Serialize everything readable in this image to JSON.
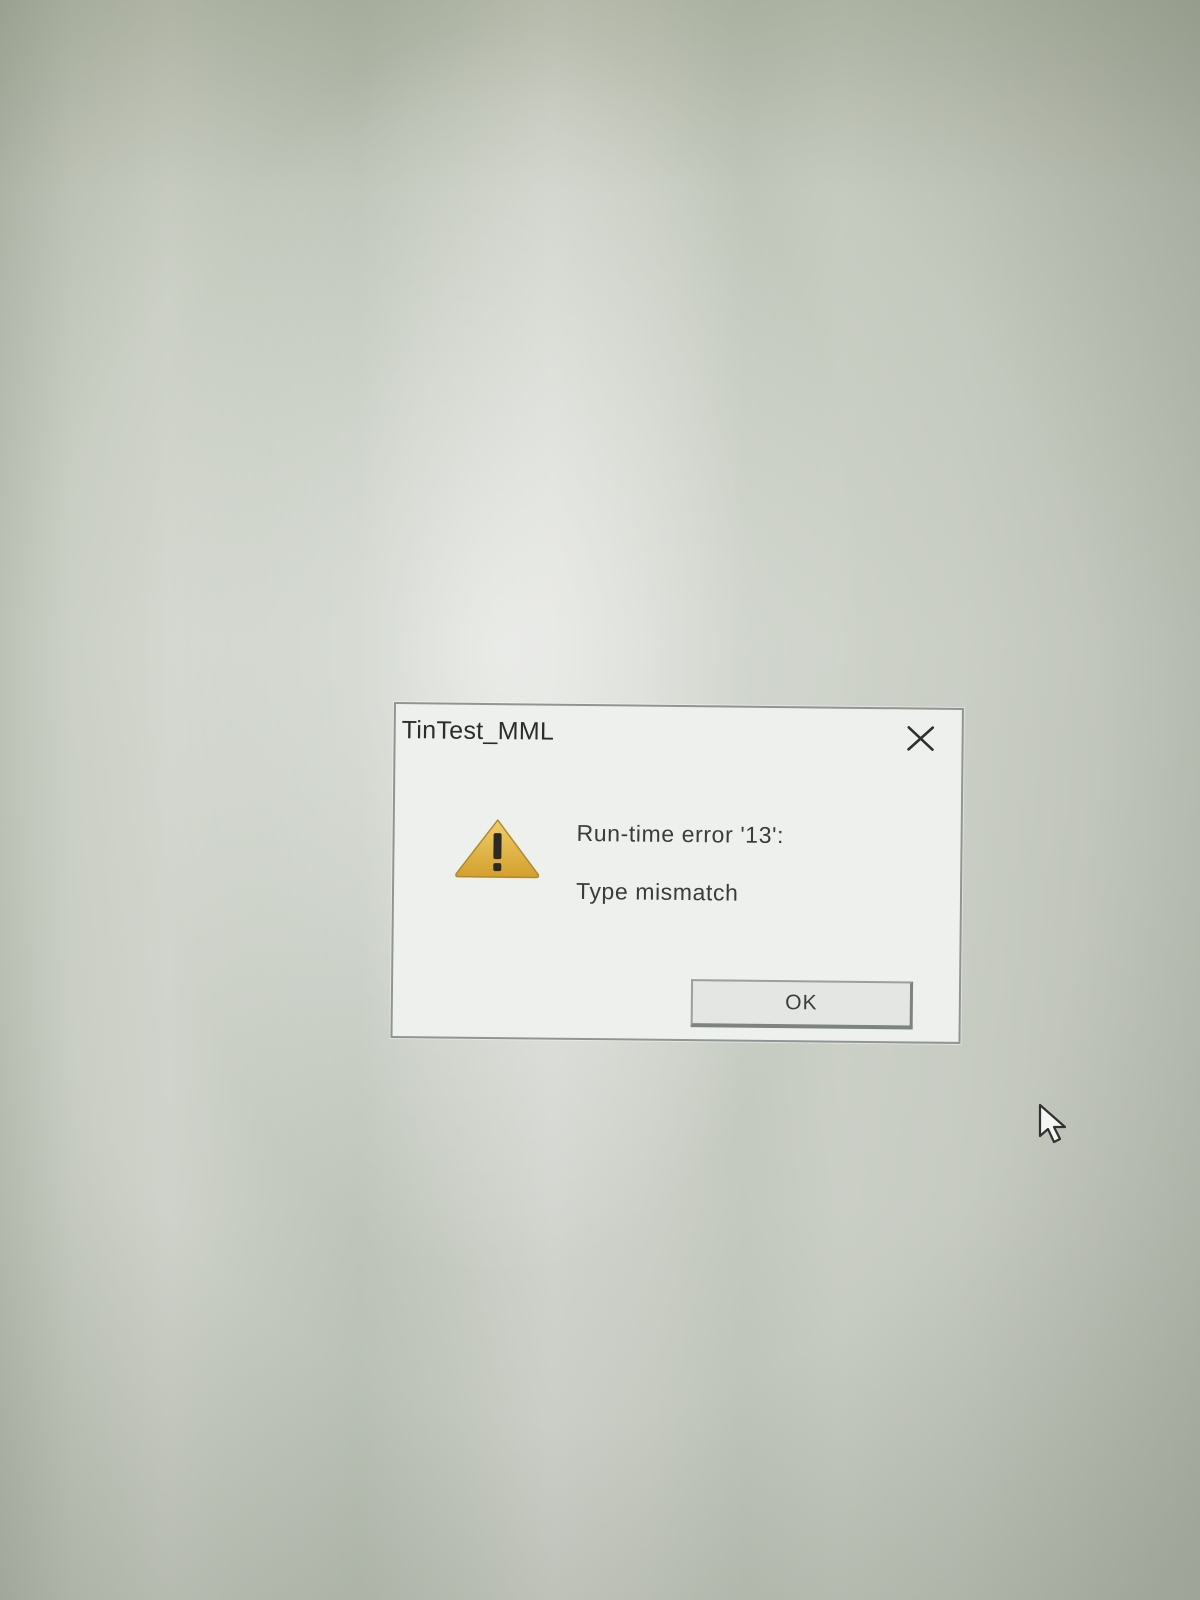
{
  "dialog": {
    "title": "TinTest_MML",
    "close_icon": "close-icon",
    "icon": "warning-icon",
    "message_title": "Run-time error '13':",
    "message_body": "Type mismatch",
    "ok_label": "OK"
  },
  "cursor": {
    "icon": "mouse-pointer-icon"
  },
  "colors": {
    "warning_fill": "#e2b33c",
    "warning_mark": "#2b2a24",
    "dialog_bg": "#eef0ed",
    "dialog_border": "#8f9592"
  }
}
